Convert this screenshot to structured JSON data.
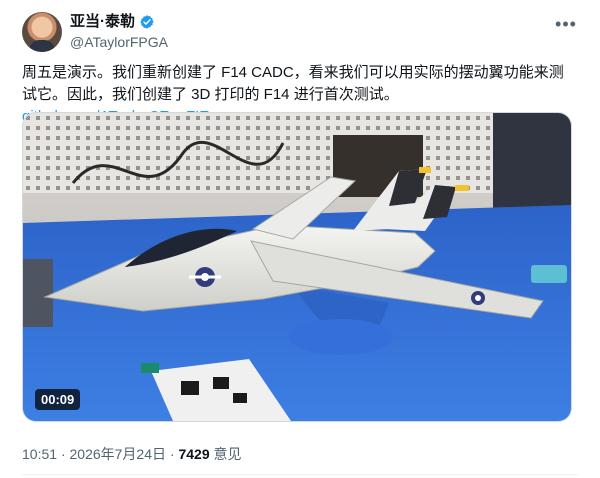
{
  "author": {
    "display_name": "亚当·泰勒",
    "handle": "@ATaylorFPGA",
    "avatar_icon": "user-avatar",
    "verified": true,
    "verified_color": "#1d9bf0"
  },
  "more_icon": "more-horizontal-icon",
  "post": {
    "text": "周五是演示。我们重新创建了 F14 CADC，看来我们可以用实际的摆动翼功能来测试它。因此，我们创建了 3D 打印的 F14 进行首次测试。",
    "link_text": "github.com/ATaylorCEngFIE…",
    "link_color": "#1d9bf0"
  },
  "media": {
    "type": "video",
    "duration": "00:09",
    "base_color": "#3f74d6",
    "model_color": "#e8e8e4"
  },
  "meta": {
    "time": "10:51",
    "separator": "·",
    "date": "2026年7月24日",
    "view_count": "7429",
    "view_label": "意见"
  }
}
